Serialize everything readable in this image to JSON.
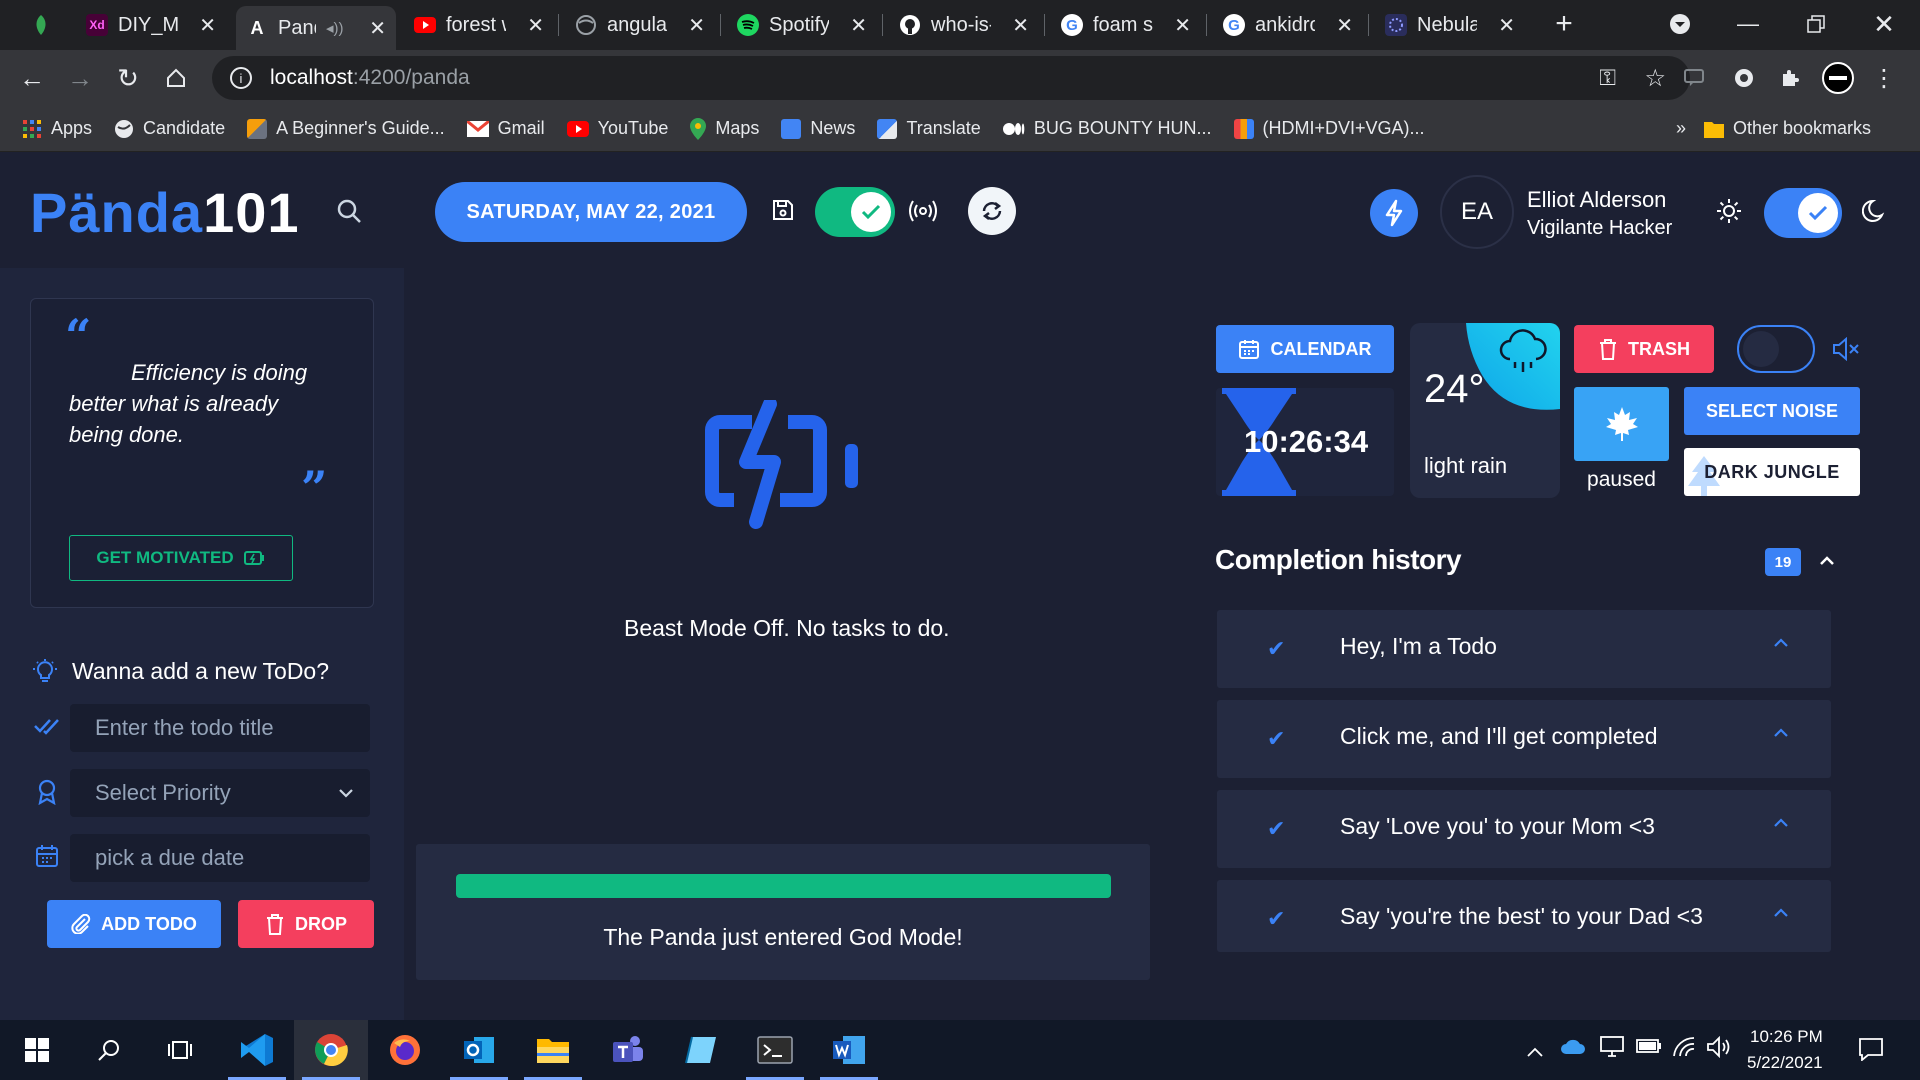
{
  "browser": {
    "tabs": [
      {
        "title": "",
        "icon": "plant-icon",
        "color": "#34a853"
      },
      {
        "title": "DIY_Mic",
        "icon": "adobe-xd-icon",
        "color": "#470137"
      },
      {
        "title": "Panda",
        "icon": "angular-icon",
        "color": "#ffffff"
      },
      {
        "title": "forest w",
        "icon": "youtube-icon",
        "color": "#ff0000"
      },
      {
        "title": "angular",
        "icon": "globe-icon",
        "color": "#9aa0a6"
      },
      {
        "title": "Spotify",
        "icon": "spotify-icon",
        "color": "#1ed760"
      },
      {
        "title": "who-is-r",
        "icon": "github-icon",
        "color": "#ffffff"
      },
      {
        "title": "foam se",
        "icon": "google-icon",
        "color": "#ffffff"
      },
      {
        "title": "ankidroi",
        "icon": "google-icon",
        "color": "#ffffff"
      },
      {
        "title": "Nebular",
        "icon": "nebular-icon",
        "color": "#3366ff"
      }
    ],
    "url_host": "localhost",
    "url_path": ":4200/panda",
    "bookmarks": [
      {
        "label": "Apps",
        "color": "#ea4335"
      },
      {
        "label": "Candidate",
        "color": "#e8eaed"
      },
      {
        "label": "A Beginner's Guide...",
        "color": "#f59e0b"
      },
      {
        "label": "Gmail",
        "color": "#ea4335"
      },
      {
        "label": "YouTube",
        "color": "#ff0000"
      },
      {
        "label": "Maps",
        "color": "#34a853"
      },
      {
        "label": "News",
        "color": "#4285f4"
      },
      {
        "label": "Translate",
        "color": "#4285f4"
      },
      {
        "label": "BUG BOUNTY HUN...",
        "color": "#ffffff"
      },
      {
        "label": "(HDMI+DVI+VGA)...",
        "color": "#f59e0b"
      }
    ],
    "bookmarks_overflow": "»",
    "other_bookmarks": "Other bookmarks"
  },
  "header": {
    "logo_part1": "Pända",
    "logo_part2": "101",
    "date": "SATURDAY, MAY 22, 2021",
    "user_initials": "EA",
    "user_name": "Elliot Alderson",
    "user_role": "Vigilante Hacker"
  },
  "sidebar": {
    "quote": "Efficiency is doing better what is already being done.",
    "motivate_label": "GET MOTIVATED",
    "add_heading": "Wanna add a new ToDo?",
    "title_placeholder": "Enter the todo title",
    "priority_placeholder": "Select Priority",
    "due_placeholder": "pick a due date",
    "add_label": "ADD TODO",
    "drop_label": "DROP"
  },
  "main": {
    "beast_message": "Beast Mode Off. No tasks to do.",
    "god_message": "The Panda just entered God Mode!",
    "progress": 1.0
  },
  "right": {
    "calendar_label": "CALENDAR",
    "timer": "10:26:34",
    "temperature": "24°",
    "weather": "light rain",
    "trash_label": "TRASH",
    "noise_status": "paused",
    "select_noise_label": "SELECT NOISE",
    "noise_name": "DARK JUNGLE",
    "history_title": "Completion history",
    "history_count": "19",
    "history_items": [
      "Hey, I'm a Todo",
      "Click me, and I'll get completed",
      "Say 'Love you' to your Mom <3",
      "Say 'you're the best' to your Dad <3"
    ]
  },
  "taskbar": {
    "time": "10:26 PM",
    "date": "5/22/2021"
  },
  "colors": {
    "accent": "#3b82f6",
    "success": "#10b981",
    "danger": "#f43f5e",
    "background": "#1c2033"
  }
}
